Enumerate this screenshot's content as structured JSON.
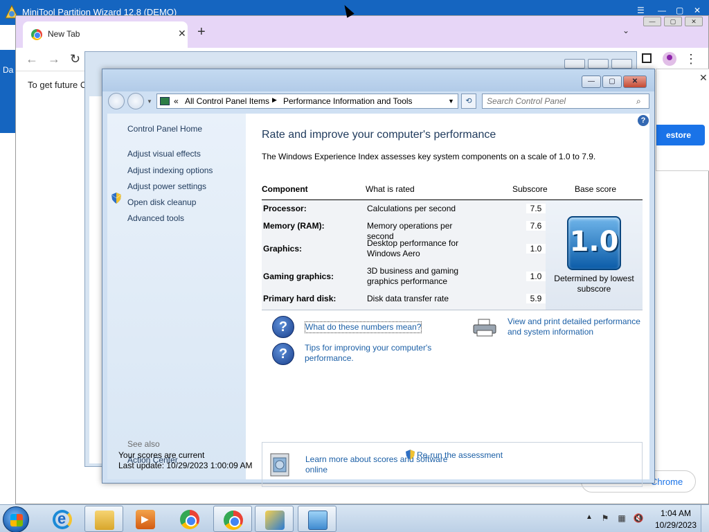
{
  "minitool": {
    "title": "MiniTool Partition Wizard 12.8 (DEMO)",
    "side_text": "Da"
  },
  "chrome": {
    "tab_title": "New Tab",
    "tab_close": "✕",
    "new_tab": "+",
    "tab_dropdown": "⌄",
    "back": "←",
    "forward": "→",
    "reload": "↻",
    "menu": "⋮",
    "info_text": "To get future C",
    "popup_close": "✕",
    "popup_button": "estore",
    "customize_button": "Chrome",
    "window_controls": [
      "—",
      "▢",
      "✕"
    ]
  },
  "cp": {
    "window_controls": {
      "minimize": "—",
      "maximize": "▢",
      "close": "✕"
    },
    "address": {
      "prefix": "«",
      "crumb1": "All Control Panel Items",
      "separator": "▶",
      "crumb2": "Performance Information and Tools",
      "dropdown": "▼"
    },
    "refresh": "⟲",
    "search": {
      "placeholder": "Search Control Panel",
      "icon": "⌕"
    },
    "sidebar": {
      "home": "Control Panel Home",
      "links": [
        "Adjust visual effects",
        "Adjust indexing options",
        "Adjust power settings",
        "Open disk cleanup",
        "Advanced tools"
      ],
      "see_also": "See also",
      "action_center": "Action Center"
    },
    "help": "?",
    "heading": "Rate and improve your computer's performance",
    "description": "The Windows Experience Index assesses key system components on a scale of 1.0 to 7.9.",
    "table": {
      "headers": {
        "component": "Component",
        "rated": "What is rated",
        "subscore": "Subscore",
        "base": "Base score"
      },
      "rows": [
        {
          "component": "Processor:",
          "rated": "Calculations per second",
          "subscore": "7.5"
        },
        {
          "component": "Memory (RAM):",
          "rated": "Memory operations per second",
          "subscore": "7.6"
        },
        {
          "component": "Graphics:",
          "rated": "Desktop performance for Windows Aero",
          "subscore": "1.0"
        },
        {
          "component": "Gaming graphics:",
          "rated": "3D business and gaming graphics performance",
          "subscore": "1.0"
        },
        {
          "component": "Primary hard disk:",
          "rated": "Disk data transfer rate",
          "subscore": "5.9"
        }
      ],
      "base_score": "1.0",
      "determined": "Determined by lowest subscore"
    },
    "links": {
      "numbers": "What do these numbers mean?",
      "tips": "Tips for improving your computer's performance.",
      "print": "View and print detailed performance and system information",
      "learn": "Learn more about scores and software online"
    },
    "status": {
      "current": "Your scores are current",
      "last_update": "Last update: 10/29/2023 1:00:09 AM",
      "rerun": "Re-run the assessment"
    }
  },
  "taskbar": {
    "time": "1:04 AM",
    "date": "10/29/2023",
    "tray_up": "▲"
  }
}
